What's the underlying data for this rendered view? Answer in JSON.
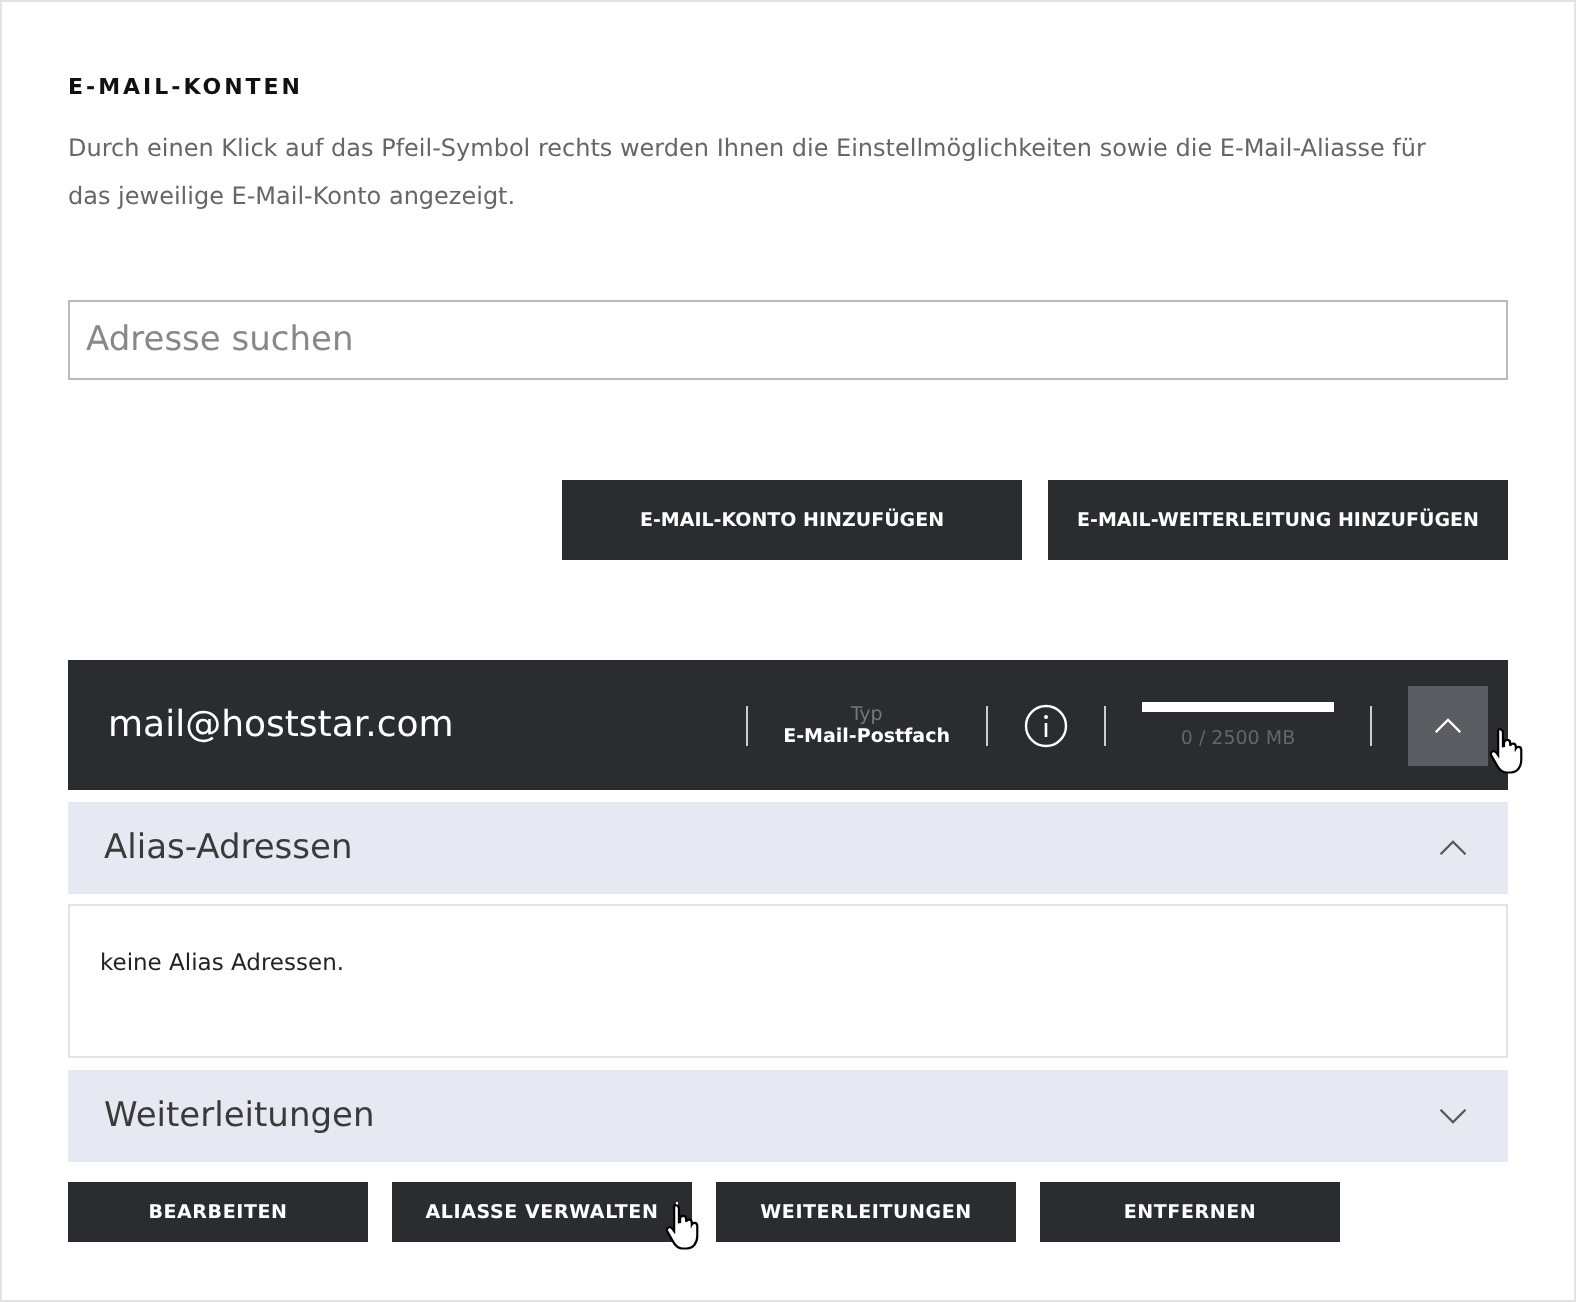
{
  "heading": "E-MAIL-KONTEN",
  "description": "Durch einen Klick auf das Pfeil-Symbol rechts werden Ihnen die Einstellmöglichkeiten sowie die E-Mail-Aliasse für das jeweilige E-Mail-Konto angezeigt.",
  "search": {
    "placeholder": "Adresse suchen"
  },
  "actions": [
    "E-MAIL-KONTO HINZUFÜGEN",
    "E-MAIL-WEITERLEITUNG HINZUFÜGEN"
  ],
  "account": {
    "address": "mail@hoststar.com",
    "type_label": "Typ",
    "type": "E-Mail-Postfach",
    "storage": {
      "reading": "0 / 2500 MB"
    },
    "expanded": true
  },
  "sections": [
    {
      "title": "Alias-Adressen",
      "expanded": true,
      "content": "keine Alias Adressen."
    },
    {
      "title": "Weiterleitungen",
      "expanded": false
    }
  ],
  "buttons": [
    {
      "label": "BEARBEITEN",
      "hover": false
    },
    {
      "label": "ALIASSE VERWALTEN",
      "hover": true
    },
    {
      "label": "WEITERLEITUNGEN",
      "hover": false
    },
    {
      "label": "ENTFERNEN",
      "hover": false
    }
  ]
}
